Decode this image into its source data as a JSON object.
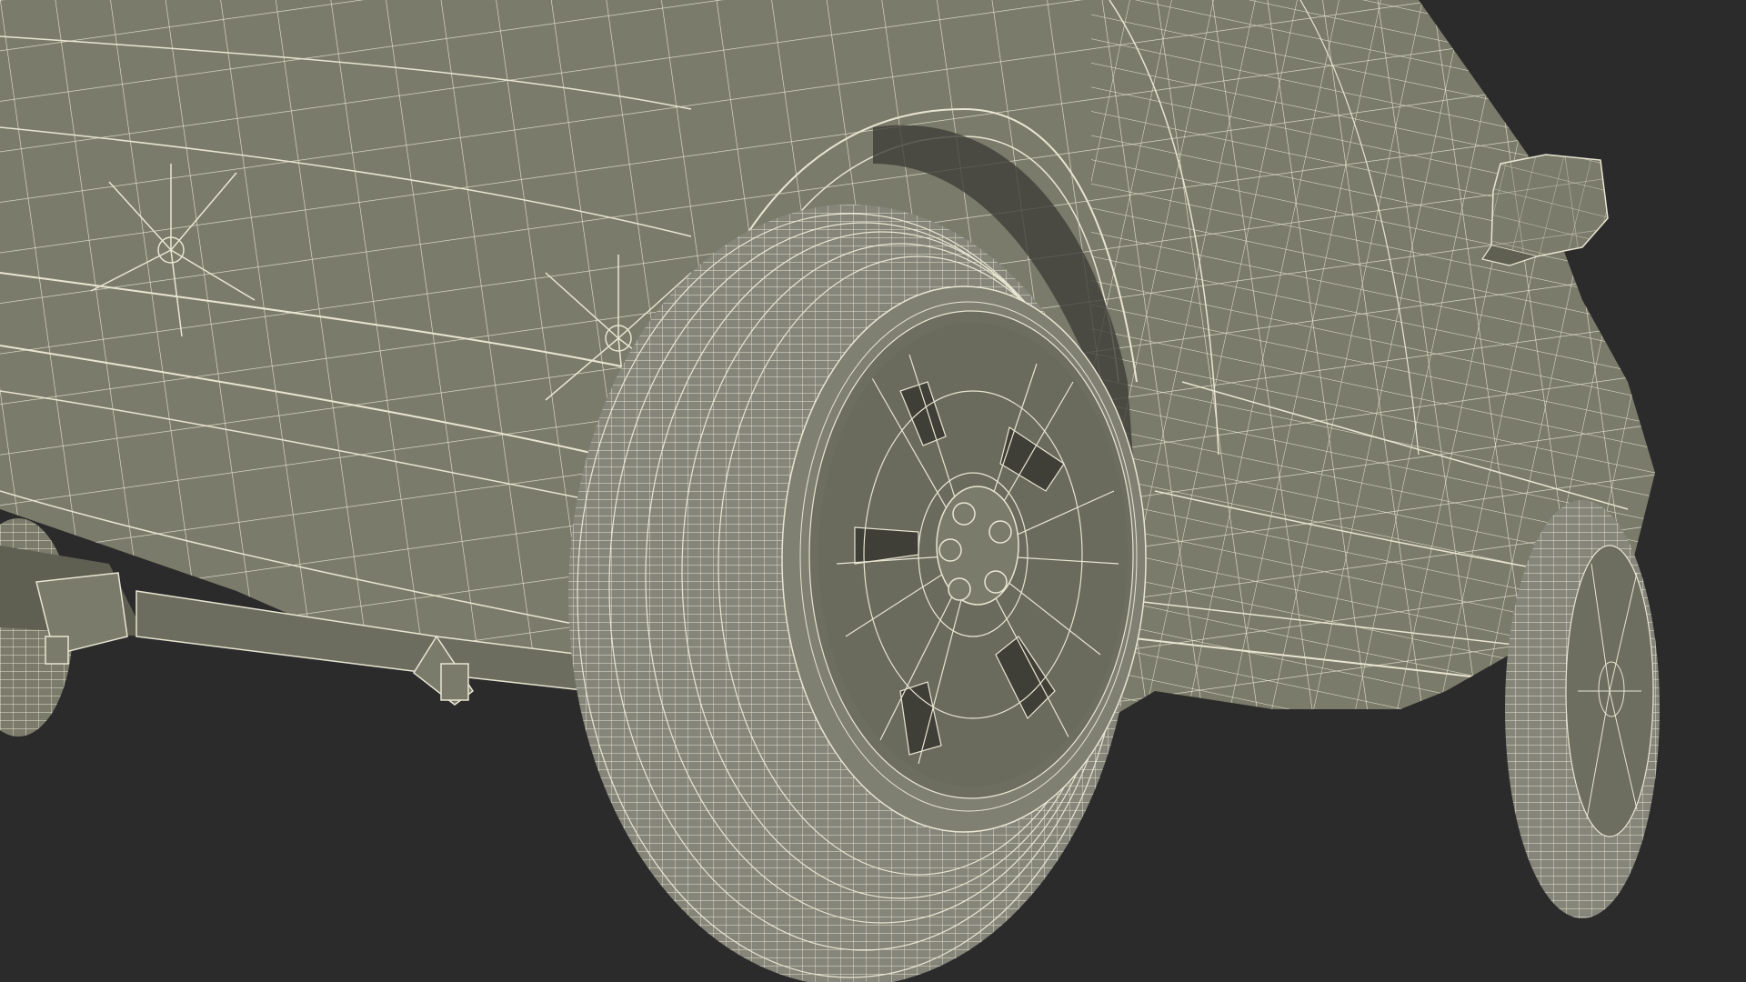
{
  "scene": {
    "subject": "wireframe-car-rear-quarter",
    "colors": {
      "background": "#2b2b2b",
      "body": "#7b7b6b",
      "body_shadow": "#5f5f52",
      "body_dark": "#3f3f38",
      "tire": "#85857a",
      "wire": "#e8e6d2",
      "wire_dense": "#d9d7c2"
    }
  }
}
